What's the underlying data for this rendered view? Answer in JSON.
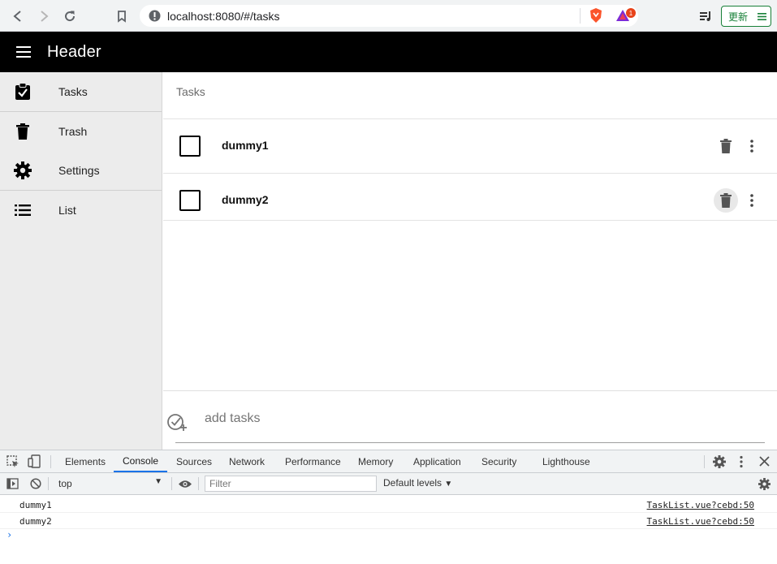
{
  "browser": {
    "url": "localhost:8080/#/tasks",
    "update_label": "更新",
    "brave_badge": "1"
  },
  "app": {
    "header_title": "Header"
  },
  "sidebar": {
    "items": [
      {
        "label": "Tasks",
        "icon": "clipboard-check-icon"
      },
      {
        "label": "Trash",
        "icon": "trash-icon"
      },
      {
        "label": "Settings",
        "icon": "gear-icon"
      },
      {
        "label": "List",
        "icon": "list-icon"
      }
    ]
  },
  "main": {
    "section_title": "Tasks",
    "tasks": [
      {
        "name": "dummy1"
      },
      {
        "name": "dummy2"
      }
    ],
    "add_placeholder": "add tasks"
  },
  "devtools": {
    "tabs": [
      "Elements",
      "Console",
      "Sources",
      "Network",
      "Performance",
      "Memory",
      "Application",
      "Security",
      "Lighthouse"
    ],
    "active_tab": "Console",
    "context": "top",
    "filter_placeholder": "Filter",
    "levels_label": "Default levels",
    "logs": [
      {
        "message": "dummy1",
        "source": "TaskList.vue?cebd:50"
      },
      {
        "message": "dummy2",
        "source": "TaskList.vue?cebd:50"
      }
    ],
    "prompt": "›"
  }
}
